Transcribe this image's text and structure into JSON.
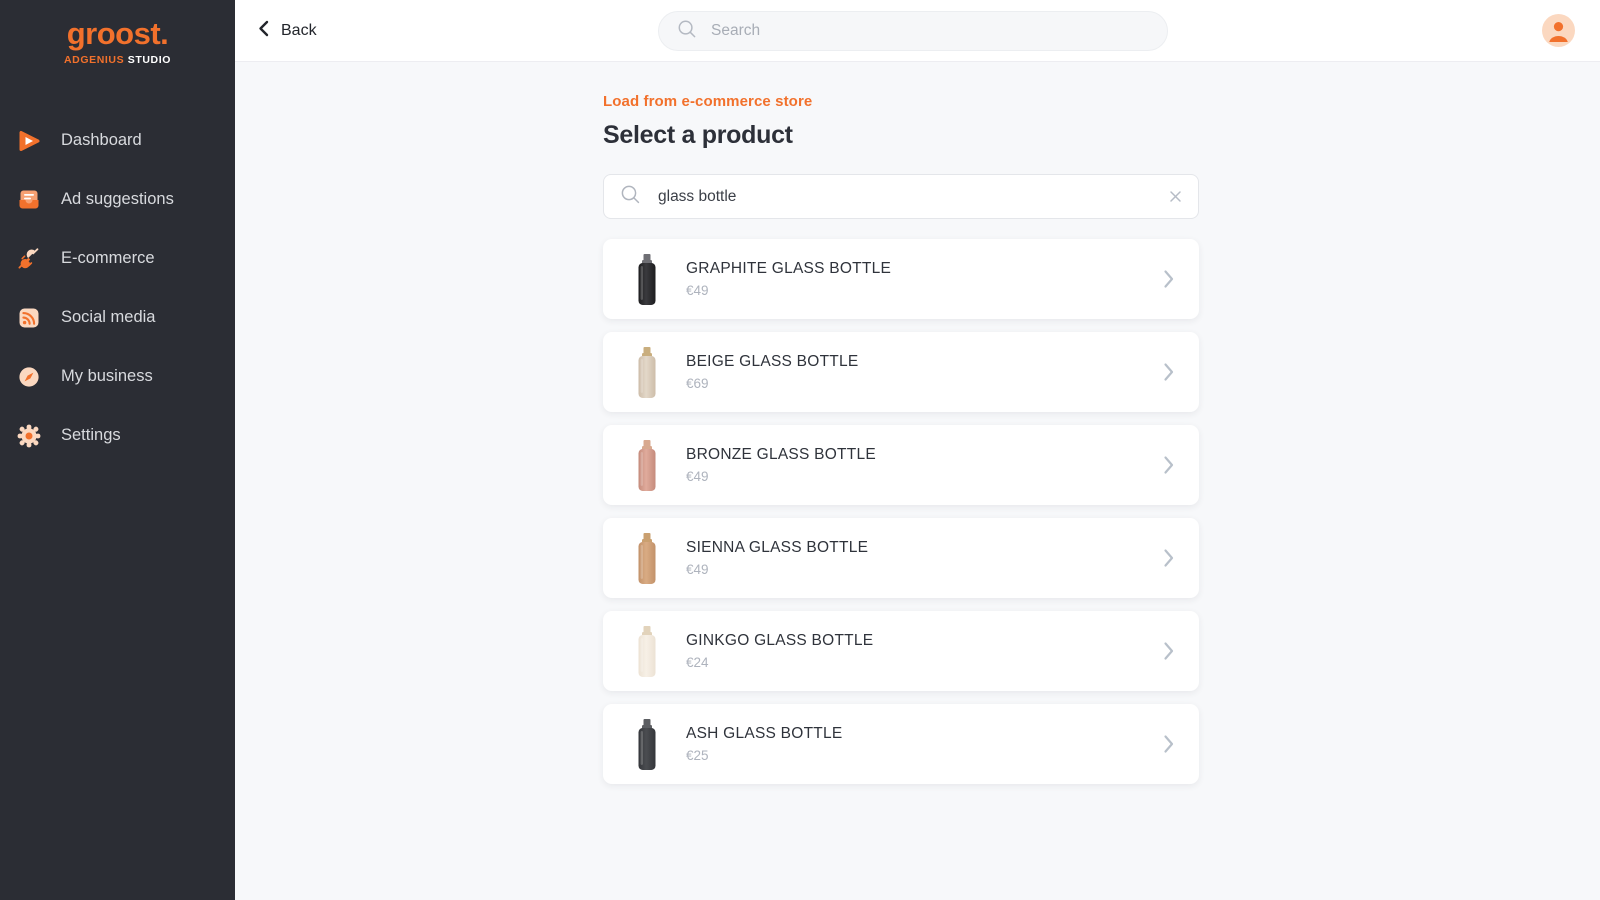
{
  "brand": {
    "logo_word": "groost.",
    "logo_sub_orange": "ADGENIUS",
    "logo_sub_white": " STUDIO",
    "accent_color": "#f2712c",
    "sidebar_color": "#2b2d34",
    "page_background": "#f7f8fa"
  },
  "sidebar": {
    "items": [
      {
        "label": "Dashboard",
        "icon": "play-icon"
      },
      {
        "label": "Ad suggestions",
        "icon": "inbox-icon"
      },
      {
        "label": "E-commerce",
        "icon": "plug-icon"
      },
      {
        "label": "Social media",
        "icon": "rss-icon"
      },
      {
        "label": "My business",
        "icon": "compass-icon"
      },
      {
        "label": "Settings",
        "icon": "gear-icon"
      }
    ]
  },
  "topbar": {
    "back_label": "Back",
    "back_icon": "chevron-left-icon",
    "search_placeholder": "Search",
    "search_value": "",
    "search_icon": "search-icon",
    "avatar_icon": "user-avatar-icon"
  },
  "main": {
    "eyebrow": "Load from e-commerce store",
    "title": "Select a product",
    "search": {
      "value": "glass bottle",
      "placeholder": "Search",
      "icon": "search-icon",
      "clear_icon": "close-icon"
    },
    "row_chevron_icon": "chevron-right-icon",
    "products": [
      {
        "name": "GRAPHITE GLASS BOTTLE",
        "price": "€49",
        "thumb": "bottle-graphite",
        "body_color": "#1d1d1f",
        "body_color2": "#3a3a3e",
        "cap_color": "#6f6f74"
      },
      {
        "name": "BEIGE GLASS BOTTLE",
        "price": "€69",
        "thumb": "bottle-beige",
        "body_color": "#cdbda9",
        "body_color2": "#e3d8c9",
        "cap_color": "#c9ae7e"
      },
      {
        "name": "BRONZE GLASS BOTTLE",
        "price": "€49",
        "thumb": "bottle-bronze",
        "body_color": "#c58b7c",
        "body_color2": "#e0ab9c",
        "cap_color": "#d8a98f"
      },
      {
        "name": "SIENNA GLASS BOTTLE",
        "price": "€49",
        "thumb": "bottle-sienna",
        "body_color": "#c2926a",
        "body_color2": "#d9ab83",
        "cap_color": "#caa070"
      },
      {
        "name": "GINKGO GLASS BOTTLE",
        "price": "€24",
        "thumb": "bottle-ginkgo",
        "body_color": "#ece2d4",
        "body_color2": "#f7f0e6",
        "cap_color": "#e2d3bb"
      },
      {
        "name": "ASH GLASS BOTTLE",
        "price": "€25",
        "thumb": "bottle-ash",
        "body_color": "#34363a",
        "body_color2": "#4b4d51",
        "cap_color": "#5c5e62"
      }
    ]
  }
}
